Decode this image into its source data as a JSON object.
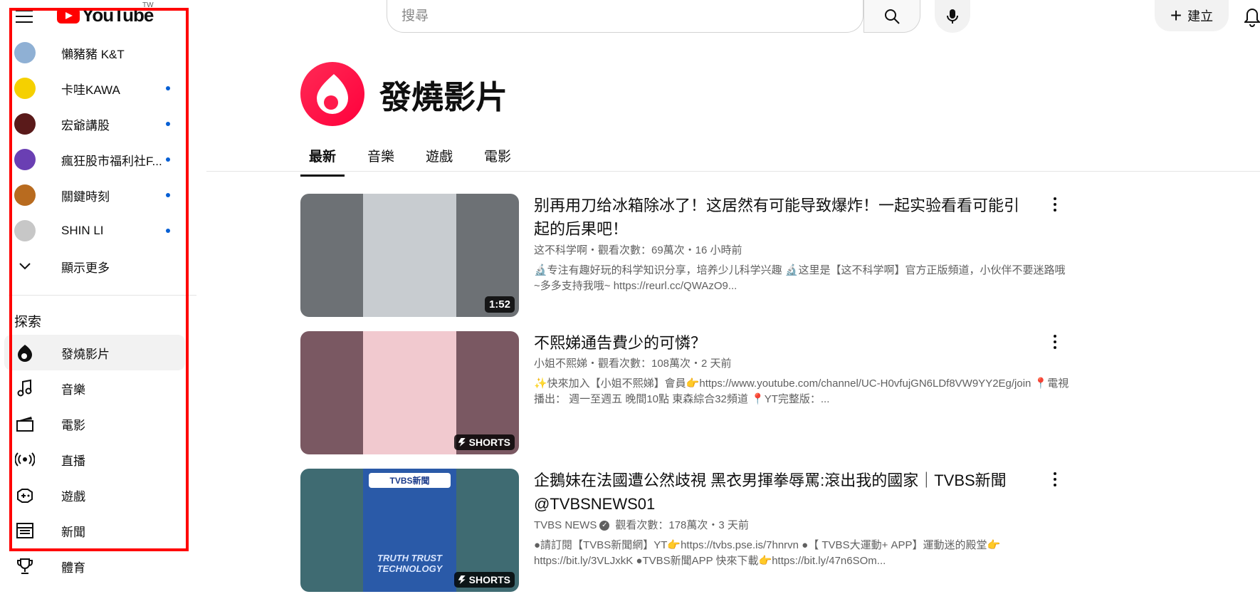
{
  "app": {
    "logo_text": "YouTube",
    "region": "TW"
  },
  "search": {
    "placeholder": "搜尋",
    "value": ""
  },
  "header": {
    "create_label": "建立"
  },
  "sidebar": {
    "subscriptions": [
      {
        "label": "懶豬豬 K&T",
        "dot": false,
        "color": "#8fb0d4"
      },
      {
        "label": "卡哇KAWA",
        "dot": true,
        "color": "#f5d000"
      },
      {
        "label": "宏爺講股",
        "dot": true,
        "color": "#5a1a1a"
      },
      {
        "label": "瘋狂股市福利社F...",
        "dot": true,
        "color": "#6a3fb3"
      },
      {
        "label": "關鍵時刻",
        "dot": true,
        "color": "#b86b1f"
      },
      {
        "label": "SHIN LI",
        "dot": true,
        "color": "#c7c7c7"
      }
    ],
    "show_more": "顯示更多",
    "explore_heading": "探索",
    "explore": [
      {
        "label": "發燒影片",
        "icon": "trending-icon",
        "active": true
      },
      {
        "label": "音樂",
        "icon": "music-icon",
        "active": false
      },
      {
        "label": "電影",
        "icon": "movie-icon",
        "active": false
      },
      {
        "label": "直播",
        "icon": "live-icon",
        "active": false
      },
      {
        "label": "遊戲",
        "icon": "gaming-icon",
        "active": false
      },
      {
        "label": "新聞",
        "icon": "news-icon",
        "active": false
      },
      {
        "label": "體育",
        "icon": "trophy-icon",
        "active": false
      }
    ]
  },
  "page": {
    "title": "發燒影片",
    "tabs": [
      {
        "label": "最新",
        "active": true
      },
      {
        "label": "音樂",
        "active": false
      },
      {
        "label": "遊戲",
        "active": false
      },
      {
        "label": "電影",
        "active": false
      }
    ]
  },
  "videos": [
    {
      "title": "别再用刀给冰箱除冰了！这居然有可能导致爆炸！一起实验看看可能引起的后果吧！",
      "meta": "这不科学啊・觀看次數：69萬次・16 小時前",
      "desc": "🔬专注有趣好玩的科学知识分享，培养少儿科学兴趣 🔬这里是【这不科学啊】官方正版頻道，小伙伴不要迷路哦~多多支持我哦~ https://reurl.cc/QWAzO9...",
      "badge": "1:52",
      "thumb_bg": "#6d7175",
      "thumb_inner": "#c8ccd0"
    },
    {
      "title": "不熙娣通告費少的可憐？",
      "meta": "小姐不熙娣・觀看次數：108萬次・2 天前",
      "desc": "✨快來加入【小姐不熙娣】會員👉https://www.youtube.com/channel/UC-H0vfujGN6LDf8VW9YY2Eg/join 📍電視播出： 週一至週五 晚間10點 東森綜合32頻道 📍YT完整版：...",
      "badge": "SHORTS",
      "thumb_bg": "#7a5862",
      "thumb_inner": "#f1c9cf"
    },
    {
      "title": "企鵝妹在法國遭公然歧視 黑衣男揮拳辱罵:滾出我的國家｜TVBS新聞 @TVBSNEWS01",
      "channel": "TVBS NEWS",
      "meta_rest": "觀看次數：178萬次・3 天前",
      "desc": "●請訂閱【TVBS新聞網】YT👉https://tvbs.pse.is/7hnrvn ●【 TVBS大運動+ APP】運動迷的殿堂👉 https://bit.ly/3VLJxkK ●TVBS新聞APP 快來下載👉https://bit.ly/47n6SOm...",
      "badge": "SHORTS",
      "thumb_bg": "#3f6b72",
      "thumb_inner": "#2a5aa8",
      "thumb_text_top": "TVBS新聞",
      "thumb_text_bottom": "TRUTH TRUST TECHNOLOGY"
    }
  ]
}
